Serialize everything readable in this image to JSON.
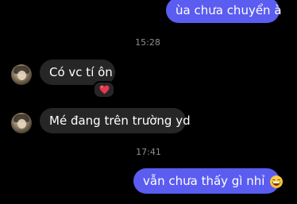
{
  "messages": [
    {
      "direction": "outgoing",
      "text": "ùa chưa chuyển à"
    },
    {
      "direction": "incoming",
      "text": "Có vc tí ôn",
      "reaction": "heart-emoji"
    },
    {
      "direction": "incoming",
      "text": "Mé đang trên trường yd"
    },
    {
      "direction": "outgoing",
      "text": "vẫn chưa thấy gì nhỉ",
      "emoji": "grinning-face-emoji"
    }
  ],
  "timestamps": [
    "15:28",
    "17:41"
  ],
  "colors": {
    "outgoing_bubble": "#5b5cf0",
    "incoming_bubble": "#262626",
    "background": "#000000",
    "timestamp": "#8e8e93",
    "reaction_heart": "#e8384f"
  }
}
